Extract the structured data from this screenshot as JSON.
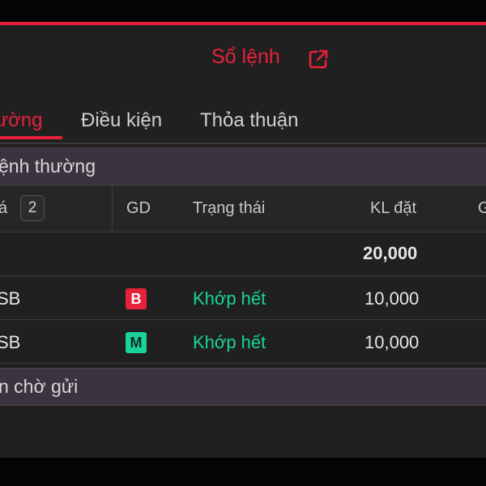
{
  "header": {
    "title": "Sổ lệnh",
    "external_icon": "external-link-icon",
    "accent_color": "#e8213b"
  },
  "tabs": [
    {
      "label": "ường",
      "active": true
    },
    {
      "label": "Điều kiện",
      "active": false
    },
    {
      "label": "Thỏa thuận",
      "active": false
    }
  ],
  "groups": {
    "normal": "ệnh thường",
    "pending": "n chờ gửi"
  },
  "columns": {
    "first": "á",
    "first_count": "2",
    "side": "GD",
    "status": "Trạng thái",
    "qty": "KL đặt",
    "next": "G"
  },
  "total_row": {
    "qty": "20,000"
  },
  "orders": [
    {
      "symbol": "SB",
      "side": "B",
      "side_color": "#e8213b",
      "status": "Khớp hết",
      "status_color": "#19d39a",
      "qty": "10,000"
    },
    {
      "symbol": "SB",
      "side": "M",
      "side_color": "#19d39a",
      "status": "Khớp hết",
      "status_color": "#19d39a",
      "qty": "10,000"
    }
  ]
}
